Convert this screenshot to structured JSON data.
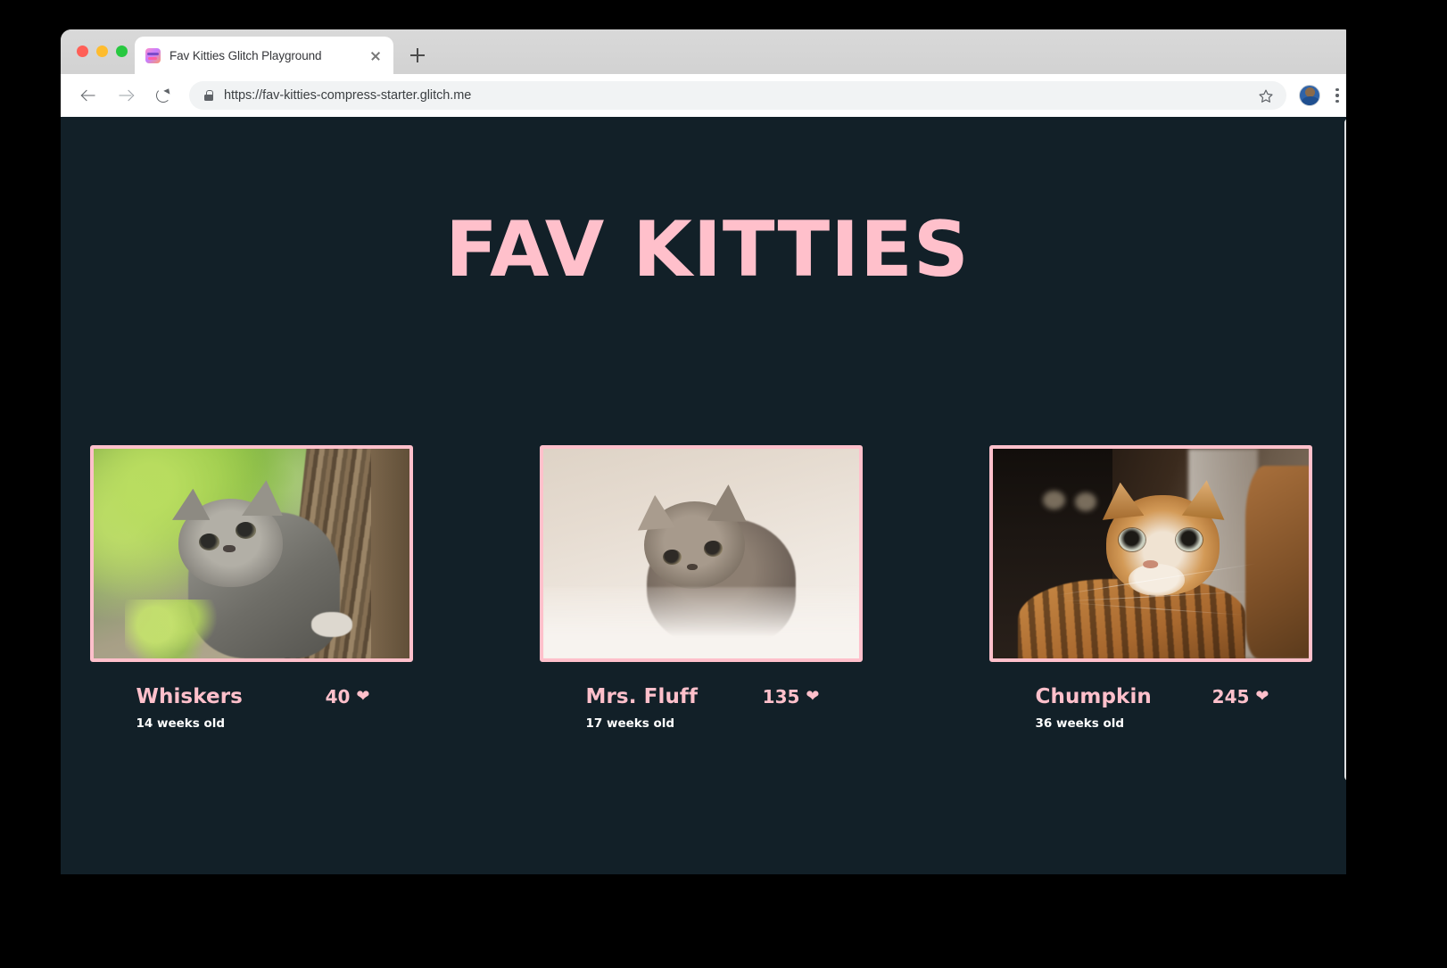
{
  "browser": {
    "tab": {
      "title": "Fav Kitties Glitch Playground",
      "favicon_name": "glitch-favicon",
      "close_label": ""
    },
    "new_tab_label": "",
    "toolbar": {
      "back_label": "",
      "forward_label": "",
      "reload_label": "",
      "url": "https://fav-kitties-compress-starter.glitch.me",
      "lock_name": "secure-lock-icon",
      "bookmark_label": "",
      "profile_label": "",
      "menu_label": ""
    }
  },
  "page": {
    "title": "FAV KITTIES",
    "background_color": "#122028",
    "accent_color": "#ffc0cb",
    "text_color": "#ffffff",
    "heart_glyph": "❤",
    "kitties": [
      {
        "name": "Whiskers",
        "age": "14 weeks old",
        "likes": "40",
        "photo_alt": "grey tabby kitten climbing beside a tree trunk"
      },
      {
        "name": "Mrs. Fluff",
        "age": "17 weeks old",
        "likes": "135",
        "photo_alt": "fluffy grey kitten lying on white bedding"
      },
      {
        "name": "Chumpkin",
        "age": "36 weeks old",
        "likes": "245",
        "photo_alt": "orange tabby cat looking upward indoors"
      }
    ]
  }
}
